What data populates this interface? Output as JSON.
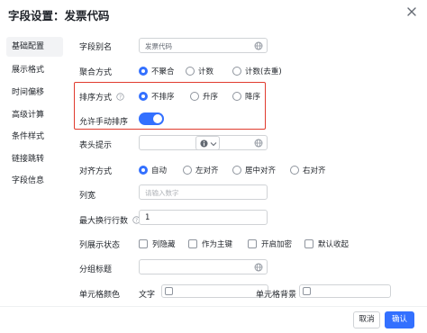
{
  "title": "字段设置：发票代码",
  "sidebar": {
    "items": [
      {
        "label": "基础配置",
        "active": true
      },
      {
        "label": "展示格式",
        "active": false
      },
      {
        "label": "时间偏移",
        "active": false
      },
      {
        "label": "高级计算",
        "active": false
      },
      {
        "label": "条件样式",
        "active": false
      },
      {
        "label": "链接跳转",
        "active": false
      },
      {
        "label": "字段信息",
        "active": false
      }
    ]
  },
  "form": {
    "alias": {
      "label": "字段别名",
      "value": "发票代码"
    },
    "aggregate": {
      "label": "聚合方式",
      "options": [
        "不聚合",
        "计数",
        "计数(去重)"
      ],
      "selected": "不聚合"
    },
    "sort": {
      "label": "排序方式",
      "options": [
        "不排序",
        "升序",
        "降序"
      ],
      "selected": "不排序"
    },
    "manual_sort": {
      "label": "允许手动排序",
      "enabled": true
    },
    "header_tip": {
      "label": "表头提示",
      "value": ""
    },
    "align": {
      "label": "对齐方式",
      "options": [
        "自动",
        "左对齐",
        "居中对齐",
        "右对齐"
      ],
      "selected": "自动"
    },
    "width": {
      "label": "列宽",
      "placeholder": "请输入数字"
    },
    "max_lines": {
      "label": "最大换行行数",
      "value": "1"
    },
    "column_state": {
      "label": "列展示状态",
      "options": [
        "列隐藏",
        "作为主键",
        "开启加密",
        "默认收起"
      ]
    },
    "group_title": {
      "label": "分组标题",
      "value": ""
    },
    "cell_color": {
      "label": "单元格颜色",
      "text_label": "文字",
      "bg_label": "单元格背景"
    }
  },
  "footer": {
    "cancel": "取消",
    "confirm": "确认"
  },
  "colors": {
    "accent": "#3370ff",
    "highlight": "#e03b2e"
  },
  "icons": [
    "close-icon",
    "globe-icon",
    "help-icon",
    "info-icon",
    "chevron-down-icon"
  ]
}
